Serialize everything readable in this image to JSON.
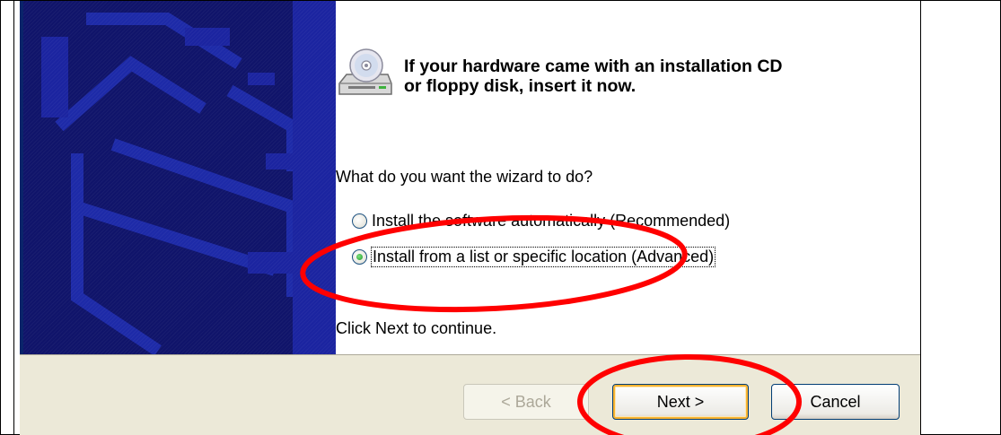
{
  "wizard": {
    "header": {
      "line1": "If your hardware came with an installation CD",
      "line2": "or floppy disk, insert it now."
    },
    "question": "What do you want the wizard to do?",
    "options": [
      {
        "label": "Install the software automatically (Recommended)",
        "selected": false
      },
      {
        "label": "Install from a list or specific location (Advanced)",
        "selected": true
      }
    ],
    "footer_note": "Click Next to continue.",
    "buttons": {
      "back": "< Back",
      "next": "Next >",
      "cancel": "Cancel"
    },
    "icons": {
      "header": "cd-drive-icon"
    },
    "colors": {
      "banner": "#10146a",
      "button_bar": "#ece9d8",
      "annotation": "#ff0000"
    }
  }
}
